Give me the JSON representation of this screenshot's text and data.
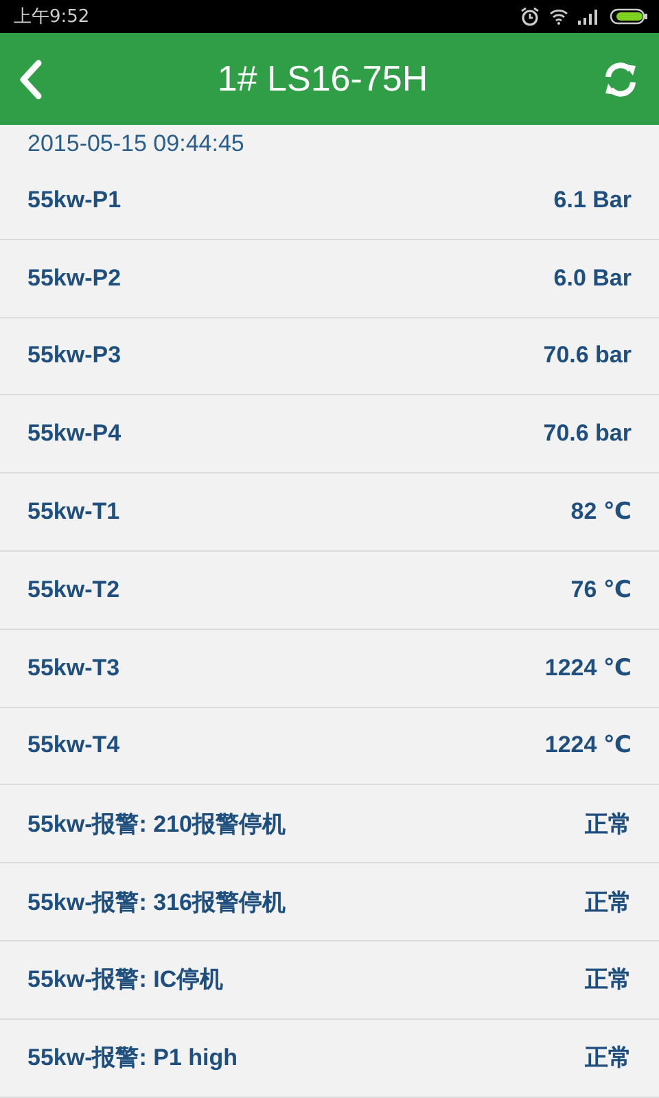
{
  "status_bar": {
    "time": "上午9:52"
  },
  "header": {
    "title": "1# LS16-75H"
  },
  "timestamp": "2015-05-15 09:44:45",
  "rows": [
    {
      "label": "55kw-P1",
      "value": "6.1 Bar"
    },
    {
      "label": "55kw-P2",
      "value": "6.0 Bar"
    },
    {
      "label": "55kw-P3",
      "value": "70.6 bar"
    },
    {
      "label": "55kw-P4",
      "value": "70.6 bar"
    },
    {
      "label": "55kw-T1",
      "value": "82 ℃"
    },
    {
      "label": "55kw-T2",
      "value": "76 ℃"
    },
    {
      "label": "55kw-T3",
      "value": "1224 ℃"
    },
    {
      "label": "55kw-T4",
      "value": "1224 ℃"
    },
    {
      "label": "55kw-报警: 210报警停机",
      "value": "正常"
    },
    {
      "label": "55kw-报警: 316报警停机",
      "value": "正常"
    },
    {
      "label": "55kw-报警: IC停机",
      "value": "正常"
    },
    {
      "label": "55kw-报警: P1 high",
      "value": "正常"
    }
  ]
}
